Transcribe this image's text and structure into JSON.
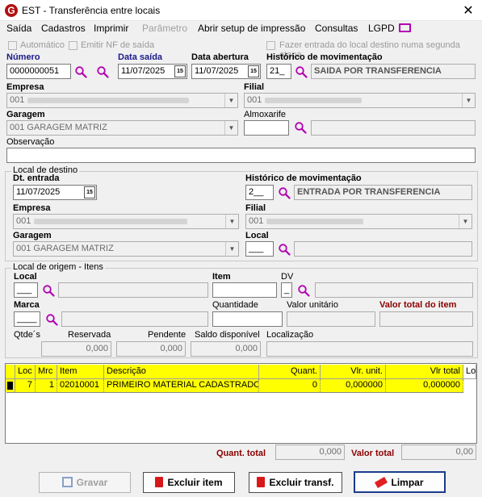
{
  "window": {
    "title": "EST - Transferência entre locais",
    "logo": "G"
  },
  "menu": [
    "Saída",
    "Cadastros",
    "Imprimir",
    "Parâmetro",
    "Abrir setup de impressão",
    "Consultas",
    "LGPD"
  ],
  "options": {
    "automatico": "Automático",
    "emitir_nf": "Emitir NF de saída",
    "fazer_entrada": "Fazer entrada do local destino numa segunda etapa"
  },
  "header": {
    "numero_label": "Número",
    "numero": "0000000051",
    "data_saida_label": "Data saída",
    "data_saida": "11/07/2025",
    "data_abertura_label": "Data abertura",
    "data_abertura": "11/07/2025",
    "historico_label": "Histórico de movimentação",
    "historico_code": "21_",
    "historico_desc": "SAIDA POR TRANSFERENCIA",
    "empresa_label": "Empresa",
    "empresa_code": "001",
    "filial_label": "Filial",
    "filial_code": "001",
    "garagem_label": "Garagem",
    "garagem": "001 GARAGEM MATRIZ",
    "almoxarife_label": "Almoxarife",
    "observacao_label": "Observação"
  },
  "destino": {
    "group_label": "Local de destino",
    "dt_entrada_label": "Dt. entrada",
    "dt_entrada": "11/07/2025",
    "historico_label": "Histórico de movimentação",
    "historico_code": "2__",
    "historico_desc": "ENTRADA POR TRANSFERENCIA",
    "empresa_label": "Empresa",
    "empresa_code": "001",
    "filial_label": "Filial",
    "filial_code": "001",
    "garagem_label": "Garagem",
    "garagem": "001 GARAGEM MATRIZ",
    "local_label": "Local",
    "local_code": "___"
  },
  "origem": {
    "group_label": "Local de origem - Itens",
    "local_label": "Local",
    "local_code": "___",
    "item_label": "Item",
    "dv_label": "DV",
    "dv_code": "_",
    "marca_label": "Marca",
    "marca_code": "____",
    "quantidade_label": "Quantidade",
    "valor_unitario_label": "Valor unitário",
    "valor_total_label": "Valor total do item",
    "qtdes_label": "Qtde´s",
    "reservada_label": "Reservada",
    "reservada": "0,000",
    "pendente_label": "Pendente",
    "pendente": "0,000",
    "saldo_label": "Saldo disponível",
    "saldo": "0,000",
    "localizacao_label": "Localização"
  },
  "grid": {
    "columns": [
      "Loc",
      "Mrc",
      "Item",
      "Descrição",
      "Quant.",
      "Vlr. unit.",
      "Vlr total",
      "Lo"
    ],
    "rows": [
      [
        "7",
        "1",
        "02010001",
        "PRIMEIRO MATERIAL CADASTRADO",
        "0",
        "0,000000",
        "0,000000",
        ""
      ]
    ]
  },
  "totals": {
    "quant_label": "Quant. total",
    "quant": "0,000",
    "valor_label": "Valor total",
    "valor": "0,00"
  },
  "buttons": {
    "gravar": "Gravar",
    "excluir_item": "Excluir item",
    "excluir_transf": "Excluir transf.",
    "limpar": "Limpar"
  },
  "colors": {
    "accent_yellow": "#ffff00",
    "label_blue": "#1a1a8c",
    "label_red": "#8a0000",
    "icon_purple": "#b200b2",
    "trash_red": "#d81818"
  }
}
